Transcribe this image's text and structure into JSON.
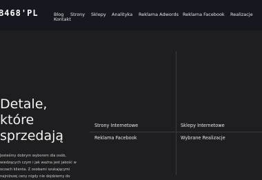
{
  "header": {
    "logo": "B468'PL",
    "nav": [
      "Blog",
      "Kontakt",
      "Strony",
      "Sklepy",
      "Analityka",
      "Reklama Adwords",
      "Reklama Facebook",
      "Realizacje"
    ]
  },
  "hero": {
    "title": "Detale, które sprzedają",
    "description": "Jesteśmy dobrym wyborem dla osób, wiedzących czym i jak ważna jest jakość w oczach klienta. Z osobami szukającymi najniższej ceny nigdy nie dojdziemy do"
  },
  "links": [
    "Strony Internetowe",
    "Sklepy Internetowe",
    "Reklama Facebook",
    "Wybrane Realizacje"
  ]
}
